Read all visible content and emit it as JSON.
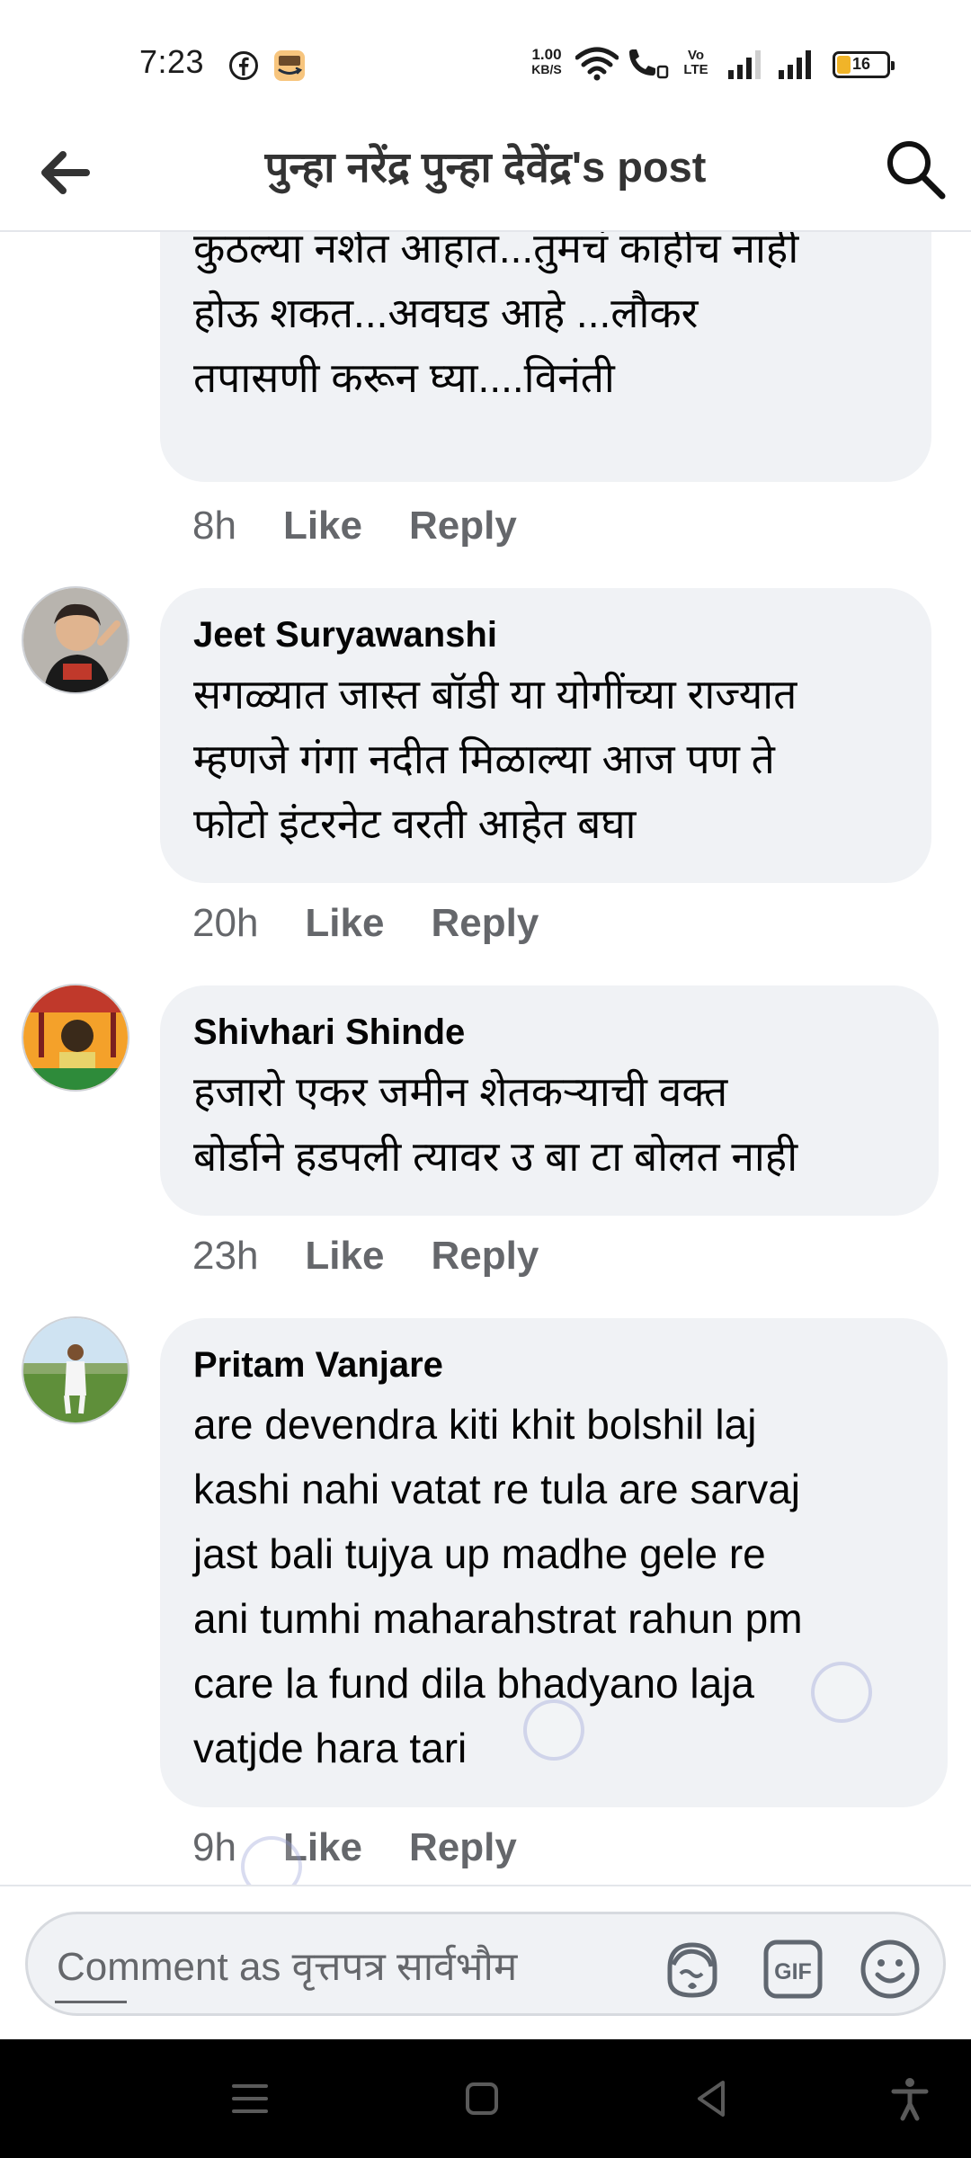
{
  "status_bar": {
    "time": "7:23",
    "speed_value": "1.00",
    "speed_unit": "KB/S",
    "volte": "Vo LTE",
    "battery": "16"
  },
  "header": {
    "title": "पुन्हा नरेंद्र पुन्हा देवेंद्र's post"
  },
  "comments": [
    {
      "author": "",
      "text": "खरच कुठल्या क्वालिटी चा माल मारता ...\nकुठल्या नशेत आहात...तुमचं काहीच नाही\nहोऊ शकत...अवघड आहे ...लौकर\nतपासणी करून घ्या....विनंती",
      "time": "8h",
      "like": "Like",
      "reply": "Reply"
    },
    {
      "author": "Jeet Suryawanshi",
      "text": "सगळ्यात जास्त बॉडी या योगींच्या राज्यात\nम्हणजे गंगा नदीत मिळाल्या आज पण ते\nफोटो इंटरनेट वरती आहेत बघा",
      "time": "20h",
      "like": "Like",
      "reply": "Reply"
    },
    {
      "author": "Shivhari Shinde",
      "text": "हजारो एकर जमीन शेतकऱ्याची वक्त\nबोर्डाने हडपली त्यावर उ बा टा बोलत नाही",
      "time": "23h",
      "like": "Like",
      "reply": "Reply"
    },
    {
      "author": "Pritam Vanjare",
      "text": "are devendra kiti khit bolshil laj\nkashi nahi vatat re tula are sarvaj\njast bali tujya up madhe gele re\nani tumhi maharahstrat rahun pm\ncare la fund dila bhadyano laja\nvatjde hara tari",
      "time": "9h",
      "like": "Like",
      "reply": "Reply"
    }
  ],
  "composer": {
    "placeholder": "Comment as वृत्तपत्र सार्वभौम",
    "avatar_icon": "avatar-sticker-icon",
    "gif_label": "GIF",
    "emoji_icon": "smiley-icon"
  },
  "colors": {
    "bubble": "#f0f2f5",
    "meta_text": "#65676b",
    "text": "#050505",
    "battery_fill": "#f0b429"
  }
}
